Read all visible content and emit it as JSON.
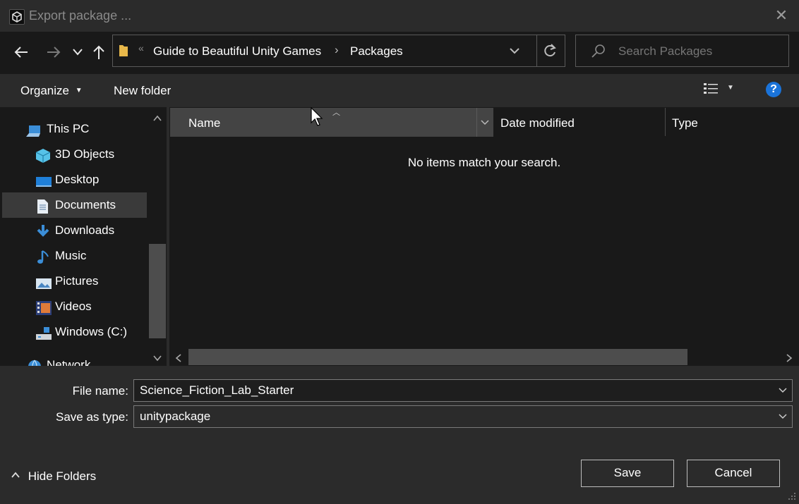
{
  "window": {
    "title": "Export package ...",
    "close_icon": "close-icon"
  },
  "nav": {
    "back_icon": "back-arrow-icon",
    "forward_icon": "forward-arrow-icon",
    "recent_icon": "chevron-down-icon",
    "up_icon": "up-arrow-icon"
  },
  "address": {
    "overflow": "«",
    "crumbs": [
      "Guide to Beautiful Unity Games",
      "Packages"
    ],
    "separator": "›"
  },
  "search": {
    "placeholder": "Search Packages"
  },
  "toolbar": {
    "organize": "Organize",
    "new_folder": "New folder",
    "help": "?"
  },
  "sidebar": {
    "items": [
      {
        "label": "This PC",
        "icon": "computer-icon"
      },
      {
        "label": "3D Objects",
        "icon": "cube-icon"
      },
      {
        "label": "Desktop",
        "icon": "desktop-icon"
      },
      {
        "label": "Documents",
        "icon": "document-icon",
        "selected": true
      },
      {
        "label": "Downloads",
        "icon": "download-icon"
      },
      {
        "label": "Music",
        "icon": "music-icon"
      },
      {
        "label": "Pictures",
        "icon": "pictures-icon"
      },
      {
        "label": "Videos",
        "icon": "videos-icon"
      },
      {
        "label": "Windows (C:)",
        "icon": "drive-icon"
      },
      {
        "label": "Network",
        "icon": "network-icon"
      }
    ]
  },
  "columns": {
    "name": "Name",
    "date_modified": "Date modified",
    "type": "Type"
  },
  "content": {
    "empty_message": "No items match your search."
  },
  "form": {
    "file_name_label": "File name:",
    "file_name_value": "Science_Fiction_Lab_Starter",
    "save_type_label": "Save as type:",
    "save_type_value": "unitypackage"
  },
  "footer": {
    "hide_folders": "Hide Folders",
    "save": "Save",
    "cancel": "Cancel"
  }
}
